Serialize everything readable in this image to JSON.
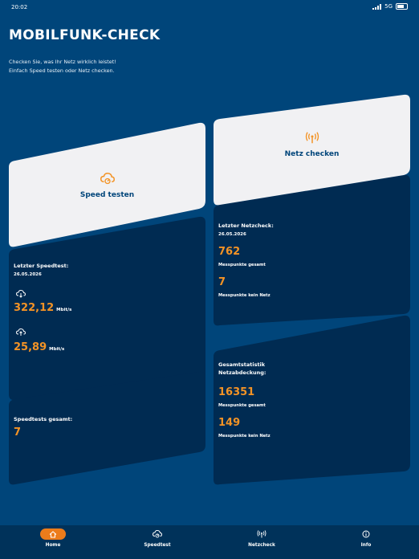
{
  "status_bar": {
    "time": "20:02",
    "network": "5G"
  },
  "header": {
    "title": "MOBILFUNK-CHECK",
    "subtitle_line1": "Checken Sie, was Ihr Netz wirklich leistet!",
    "subtitle_line2": "Einfach Speed testen oder Netz checken."
  },
  "actions": {
    "speed_test": {
      "label": "Speed testen",
      "icon": "cloud-speed-icon"
    },
    "network_check": {
      "label": "Netz checken",
      "icon": "antenna-icon"
    }
  },
  "last_speedtest": {
    "title": "Letzter Speedtest:",
    "date": "26.05.2026",
    "download_value": "322,12",
    "download_unit": "Mbit/s",
    "upload_value": "25,89",
    "upload_unit": "Mbit/s"
  },
  "speedtests_total": {
    "title": "Speedtests gesamt:",
    "value": "7"
  },
  "last_netcheck": {
    "title": "Letzter Netzcheck:",
    "date": "26.05.2026",
    "points_total_value": "762",
    "points_total_label": "Messpunkte gesamt",
    "points_no_net_value": "7",
    "points_no_net_label": "Messpunkte kein Netz"
  },
  "coverage_stats": {
    "title_line1": "Gesamtstatistik",
    "title_line2": "Netzabdeckung:",
    "points_total_value": "16351",
    "points_total_label": "Messpunkte gesamt",
    "points_no_net_value": "149",
    "points_no_net_label": "Messpunkte kein Netz"
  },
  "tabbar": {
    "items": [
      {
        "label": "Home",
        "icon": "home-icon",
        "active": true
      },
      {
        "label": "Speedtest",
        "icon": "speedtest-icon",
        "active": false
      },
      {
        "label": "Netzcheck",
        "icon": "antenna-icon",
        "active": false
      },
      {
        "label": "Info",
        "icon": "info-icon",
        "active": false
      }
    ]
  },
  "colors": {
    "background": "#00457a",
    "panel": "#002b52",
    "card": "#f1f1f3",
    "accent": "#f39325",
    "tabbar": "#00325a"
  }
}
